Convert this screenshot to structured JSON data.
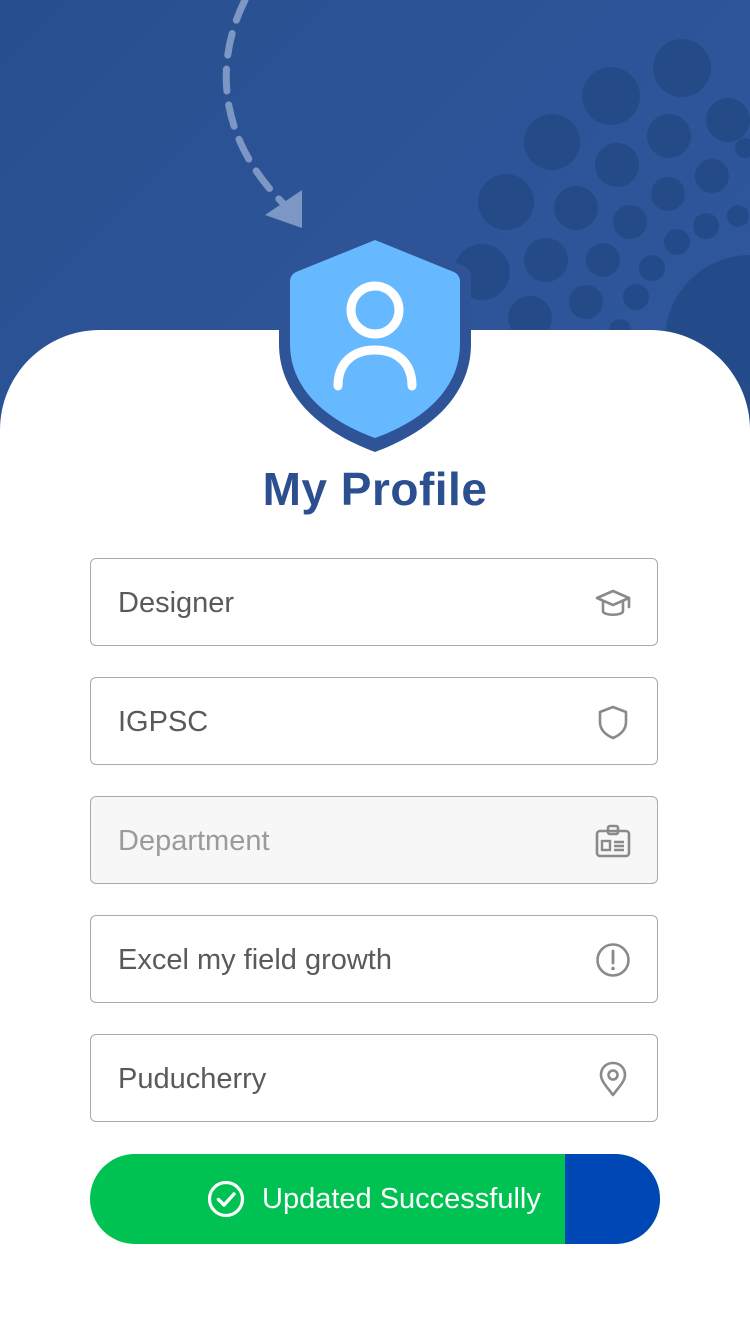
{
  "page": {
    "title": "My Profile"
  },
  "fields": [
    {
      "value": "Designer",
      "icon": "graduation-cap-icon",
      "disabled": false
    },
    {
      "value": "IGPSC",
      "icon": "shield-icon",
      "disabled": false
    },
    {
      "placeholder": "Department",
      "icon": "id-card-icon",
      "disabled": true
    },
    {
      "value": "Excel my field growth",
      "icon": "alert-circle-icon",
      "disabled": false
    },
    {
      "value": "Puducherry",
      "icon": "map-pin-icon",
      "disabled": false
    }
  ],
  "status_button": {
    "label": "Updated Successfully",
    "icon": "check-circle-icon"
  },
  "colors": {
    "header": "#2d5498",
    "title": "#2b4f8f",
    "shield": "#66b8ff",
    "success": "#00c252",
    "accent": "#0047b6"
  }
}
